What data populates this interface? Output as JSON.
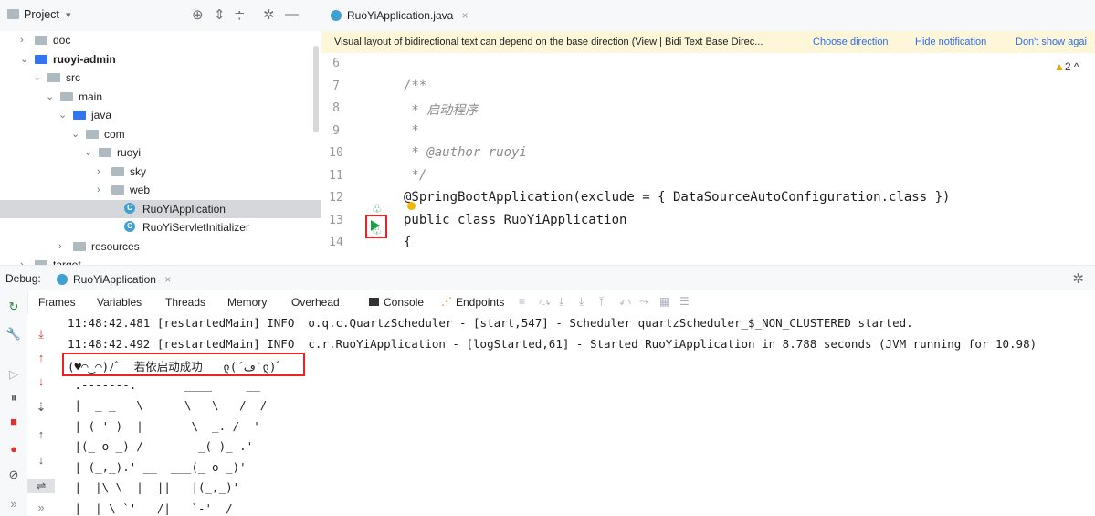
{
  "project_panel": {
    "title": "Project",
    "tree": [
      {
        "label": "doc",
        "chev": ">",
        "type": "folder"
      },
      {
        "label": "ruoyi-admin",
        "chev": "v",
        "type": "module",
        "bold": true
      },
      {
        "label": "src",
        "chev": "v",
        "type": "folder"
      },
      {
        "label": "main",
        "chev": "v",
        "type": "folder"
      },
      {
        "label": "java",
        "chev": "v",
        "type": "src-folder"
      },
      {
        "label": "com",
        "chev": "v",
        "type": "package"
      },
      {
        "label": "ruoyi",
        "chev": "v",
        "type": "package"
      },
      {
        "label": "sky",
        "chev": ">",
        "type": "package"
      },
      {
        "label": "web",
        "chev": ">",
        "type": "package"
      },
      {
        "label": "RuoYiApplication",
        "chev": "",
        "type": "class",
        "selected": true
      },
      {
        "label": "RuoYiServletInitializer",
        "chev": "",
        "type": "class"
      },
      {
        "label": "resources",
        "chev": ">",
        "type": "res-folder"
      },
      {
        "label": "target",
        "chev": ">",
        "type": "folder"
      }
    ]
  },
  "editor": {
    "tab_label": "RuoYiApplication.java",
    "tab_close": "×",
    "notice": {
      "message": "Visual layout of bidirectional text can depend on the base direction (View | Bidi Text Base Direc...",
      "link1": "Choose direction",
      "link2": "Hide notification",
      "link3": "Don't show agai"
    },
    "warnings": "▲2",
    "lines": [
      {
        "num": "6",
        "code": ""
      },
      {
        "num": "7",
        "code": "/**"
      },
      {
        "num": "8",
        "code": " * 启动程序"
      },
      {
        "num": "9",
        "code": " *"
      },
      {
        "num": "10",
        "code": " * @author ruoyi"
      },
      {
        "num": "11",
        "code": " */"
      },
      {
        "num": "12",
        "code": "@SpringBootApplication(exclude = { DataSourceAutoConfiguration.class })"
      },
      {
        "num": "13",
        "code": "public class RuoYiApplication"
      },
      {
        "num": "14",
        "code": "{"
      }
    ]
  },
  "debug": {
    "label": "Debug:",
    "tab_label": "RuoYiApplication",
    "tab_close": "×",
    "subtabs": [
      "Frames",
      "Variables",
      "Threads",
      "Memory",
      "Overhead",
      "Console",
      "Endpoints"
    ],
    "console_lines": [
      "11:48:42.481 [restartedMain] INFO  o.q.c.QuartzScheduler - [start,547] - Scheduler quartzScheduler_$_NON_CLUSTERED started.",
      "11:48:42.492 [restartedMain] INFO  c.r.RuoYiApplication - [logStarted,61] - Started RuoYiApplication in 8.788 seconds (JVM running for 10.98)",
      "(♥◠‿◠)ﾉﾞ  若依启动成功   ლ(´ڡ`ლ)ﾞ",
      " .-------.       ____     __",
      " |  _ _   \\      \\   \\   /  /",
      " | ( ' )  |       \\  _. /  '",
      " |(_ o _) /        _( )_ .'",
      " | (_,_).' __  ___(_ o _)'",
      " |  |\\ \\  |  ||   |(_,_)'",
      " |  | \\ `'   /|   `-'  /"
    ]
  }
}
